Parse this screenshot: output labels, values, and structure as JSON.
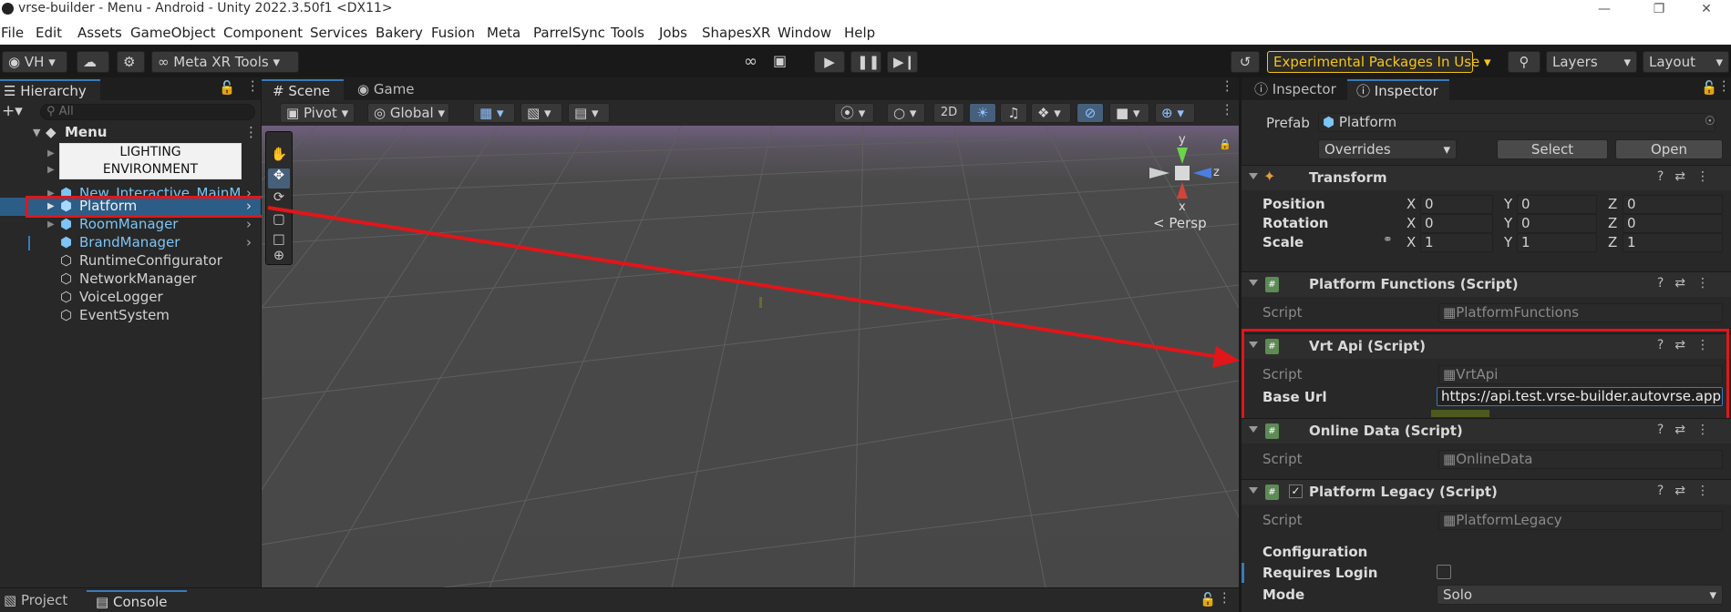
{
  "titlebar": {
    "title": "vrse-builder - Menu - Android - Unity 2022.3.50f1 <DX11>"
  },
  "menu": [
    "File",
    "Edit",
    "Assets",
    "GameObject",
    "Component",
    "Services",
    "Bakery",
    "Fusion",
    "Meta",
    "ParrelSync",
    "Tools",
    "Jobs",
    "ShapesXR",
    "Window",
    "Help"
  ],
  "toolbar": {
    "account": "VH",
    "meta_tools": "Meta XR Tools",
    "experimental": "Experimental Packages In Use",
    "layers": "Layers",
    "layout": "Layout"
  },
  "hierarchy": {
    "tab": "Hierarchy",
    "search_placeholder": "All",
    "scene": "Menu",
    "banner_line1": "LIGHTING",
    "banner_line2": "ENVIRONMENT",
    "items": [
      {
        "label": "New_Interactive_MainM"
      },
      {
        "label": "Platform"
      },
      {
        "label": "RoomManager"
      },
      {
        "label": "BrandManager"
      },
      {
        "label": "RuntimeConfigurator"
      },
      {
        "label": "NetworkManager"
      },
      {
        "label": "VoiceLogger"
      },
      {
        "label": "EventSystem"
      }
    ]
  },
  "scene_view": {
    "tabs": [
      "Scene",
      "Game"
    ],
    "pivot": "Pivot",
    "global": "Global",
    "mode_2d": "2D",
    "persp": "Persp",
    "axis_y": "y",
    "axis_x": "x",
    "axis_z": "z"
  },
  "inspector": {
    "tabs": [
      "Inspector",
      "Inspector"
    ],
    "prefab_label": "Prefab",
    "prefab_value": "Platform",
    "overrides": "Overrides",
    "select": "Select",
    "open": "Open",
    "transform": {
      "name": "Transform",
      "position_label": "Position",
      "rotation_label": "Rotation",
      "scale_label": "Scale",
      "position": [
        "0",
        "0",
        "0"
      ],
      "rotation": [
        "0",
        "0",
        "0"
      ],
      "scale": [
        "1",
        "1",
        "1"
      ]
    },
    "axis_x": "X",
    "axis_y": "Y",
    "axis_z": "Z",
    "script_label": "Script",
    "platform_functions": {
      "name": "Platform Functions (Script)",
      "script": "PlatformFunctions"
    },
    "vrt_api": {
      "name": "Vrt Api (Script)",
      "script": "VrtApi",
      "base_url_label": "Base Url",
      "base_url": "https://api.test.vrse-builder.autovrse.app"
    },
    "online_data": {
      "name": "Online Data (Script)",
      "script": "OnlineData"
    },
    "platform_legacy": {
      "name": "Platform Legacy (Script)",
      "script": "PlatformLegacy",
      "configuration": "Configuration",
      "requires_login": "Requires Login",
      "mode_label": "Mode",
      "mode_value": "Solo"
    }
  },
  "bottom": {
    "project": "Project",
    "console": "Console"
  },
  "colors": {
    "accent_selection": "#2c5d87",
    "annotation_red": "#e0161a",
    "experimental_yellow": "#f5c518"
  }
}
